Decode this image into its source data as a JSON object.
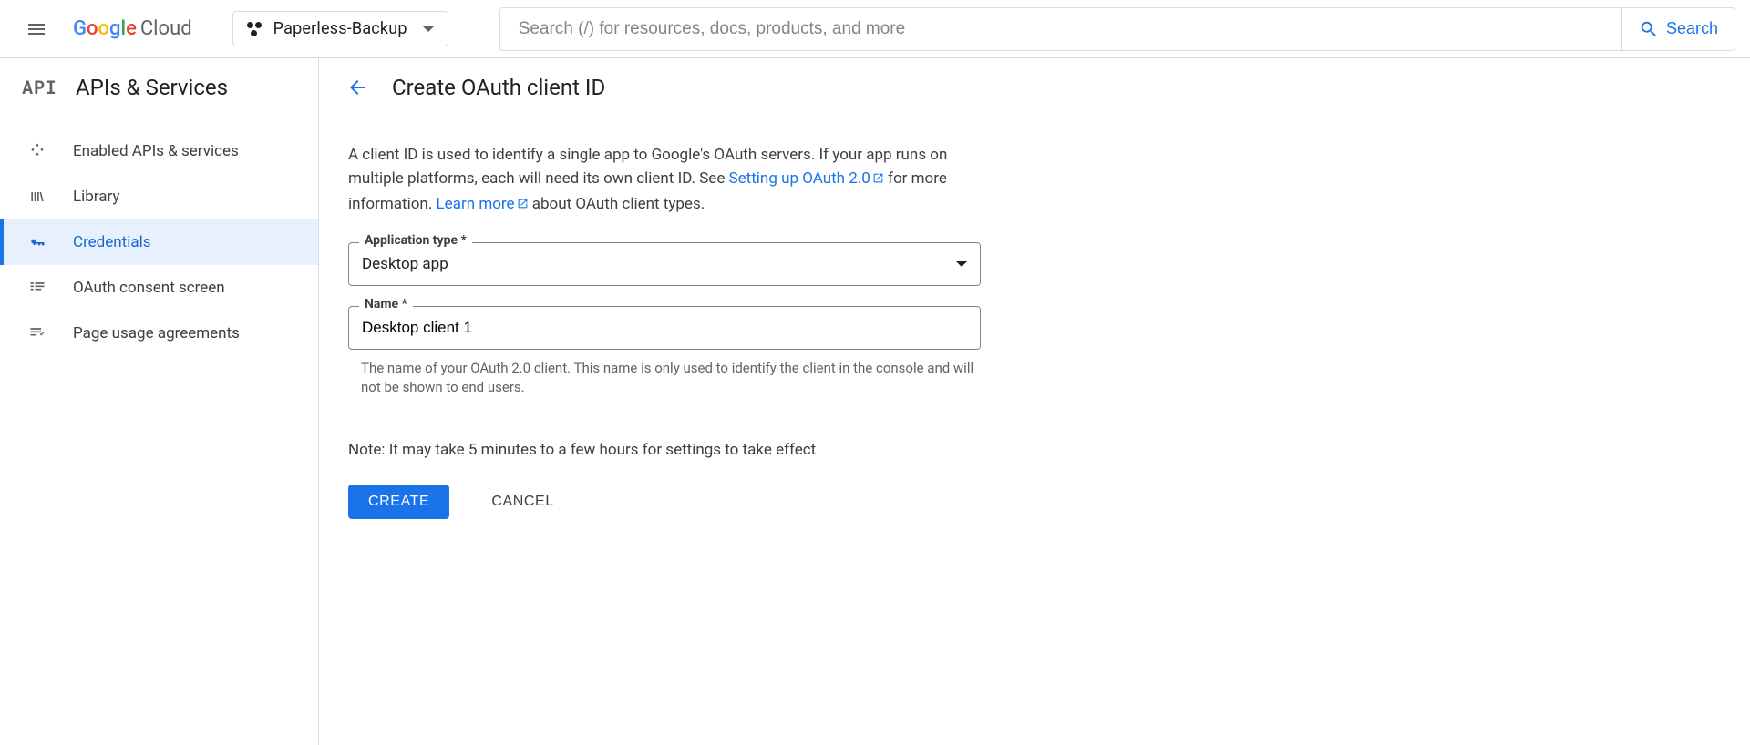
{
  "header": {
    "logo_google": "Google",
    "logo_cloud": "Cloud",
    "project_name": "Paperless-Backup",
    "search_placeholder": "Search (/) for resources, docs, products, and more",
    "search_button": "Search"
  },
  "sidebar": {
    "api_label": "API",
    "title": "APIs & Services",
    "items": [
      {
        "label": "Enabled APIs & services"
      },
      {
        "label": "Library"
      },
      {
        "label": "Credentials"
      },
      {
        "label": "OAuth consent screen"
      },
      {
        "label": "Page usage agreements"
      }
    ]
  },
  "main": {
    "page_title": "Create OAuth client ID",
    "description": {
      "text1": "A client ID is used to identify a single app to Google's OAuth servers. If your app runs on multiple platforms, each will need its own client ID. See ",
      "link1": "Setting up OAuth 2.0",
      "text2": " for more information. ",
      "link2": "Learn more",
      "text3": " about OAuth client types."
    },
    "form": {
      "app_type_label": "Application type *",
      "app_type_value": "Desktop app",
      "name_label": "Name *",
      "name_value": "Desktop client 1",
      "name_helper": "The name of your OAuth 2.0 client. This name is only used to identify the client in the console and will not be shown to end users."
    },
    "note": "Note: It may take 5 minutes to a few hours for settings to take effect",
    "actions": {
      "create": "CREATE",
      "cancel": "CANCEL"
    }
  }
}
